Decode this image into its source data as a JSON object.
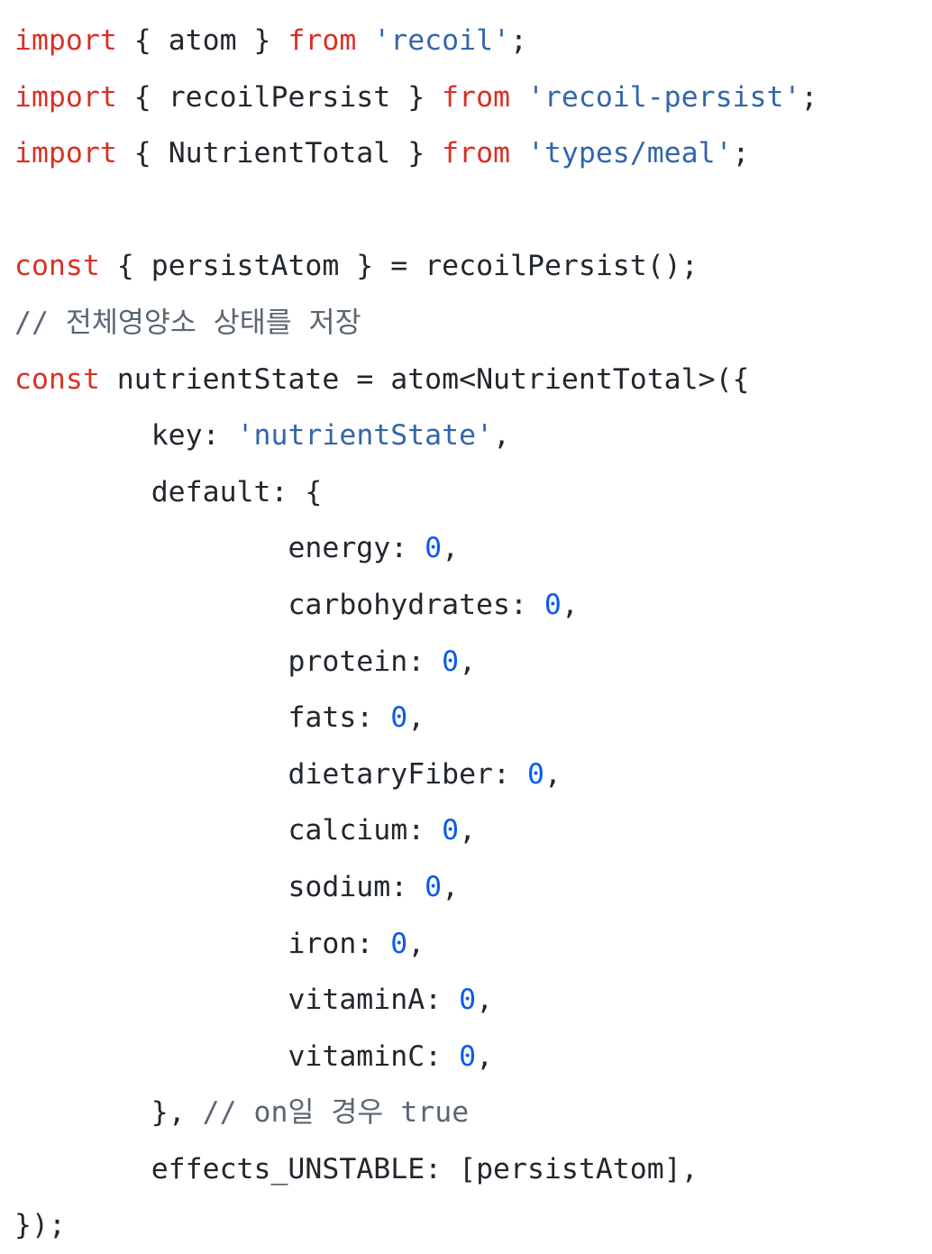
{
  "editor": {
    "language": "typescript",
    "background": "#ffffff",
    "colors": {
      "keyword": "#d93025",
      "string": "#3366aa",
      "function": "#7b5fc4",
      "property": "#2d6bbf",
      "number": "#0a5ce8",
      "comment": "#5a6672",
      "punctuation": "#c88a28",
      "plain": "#22272e",
      "operator": "#2d6bbf"
    }
  },
  "code": {
    "lines": [
      {
        "index": 1,
        "text": "import { atom } from 'recoil';",
        "tokens": [
          {
            "t": "import",
            "c": "keyword"
          },
          {
            "t": " ",
            "c": "plain"
          },
          {
            "t": "{ atom }",
            "c": "plain"
          },
          {
            "t": " ",
            "c": "plain"
          },
          {
            "t": "from",
            "c": "keyword"
          },
          {
            "t": " ",
            "c": "plain"
          },
          {
            "t": "'recoil'",
            "c": "string"
          },
          {
            "t": ";",
            "c": "plain"
          }
        ]
      },
      {
        "index": 2,
        "text": "import { recoilPersist } from 'recoil-persist';",
        "tokens": [
          {
            "t": "import",
            "c": "keyword"
          },
          {
            "t": " ",
            "c": "plain"
          },
          {
            "t": "{ recoilPersist }",
            "c": "plain"
          },
          {
            "t": " ",
            "c": "plain"
          },
          {
            "t": "from",
            "c": "keyword"
          },
          {
            "t": " ",
            "c": "plain"
          },
          {
            "t": "'recoil-persist'",
            "c": "string"
          },
          {
            "t": ";",
            "c": "plain"
          }
        ]
      },
      {
        "index": 3,
        "text": "import { NutrientTotal } from 'types/meal';",
        "tokens": [
          {
            "t": "import",
            "c": "keyword"
          },
          {
            "t": " ",
            "c": "plain"
          },
          {
            "t": "{ NutrientTotal }",
            "c": "plain"
          },
          {
            "t": " ",
            "c": "plain"
          },
          {
            "t": "from",
            "c": "keyword"
          },
          {
            "t": " ",
            "c": "plain"
          },
          {
            "t": "'types/meal'",
            "c": "string"
          },
          {
            "t": ";",
            "c": "plain"
          }
        ]
      },
      {
        "index": 4,
        "text": "",
        "tokens": []
      },
      {
        "index": 5,
        "text": "const { persistAtom } = recoilPersist();",
        "tokens": [
          {
            "t": "const",
            "c": "keyword"
          },
          {
            "t": " ",
            "c": "plain"
          },
          {
            "t": "{ persistAtom }",
            "c": "plain"
          },
          {
            "t": " ",
            "c": "plain"
          },
          {
            "t": "=",
            "c": "operator"
          },
          {
            "t": " ",
            "c": "plain"
          },
          {
            "t": "recoilPersist",
            "c": "function"
          },
          {
            "t": "()",
            "c": "punctuation"
          },
          {
            "t": ";",
            "c": "plain"
          }
        ]
      },
      {
        "index": 6,
        "text": "// 전체영양소 상태를 저장",
        "tokens": [
          {
            "t": "// 전체영양소 상태를 저장",
            "c": "comment"
          }
        ]
      },
      {
        "index": 7,
        "text": "const nutrientState = atom<NutrientTotal>({",
        "tokens": [
          {
            "t": "const",
            "c": "keyword"
          },
          {
            "t": " nutrientState ",
            "c": "plain"
          },
          {
            "t": "=",
            "c": "operator"
          },
          {
            "t": " ",
            "c": "plain"
          },
          {
            "t": "atom",
            "c": "function"
          },
          {
            "t": "<NutrientTotal>",
            "c": "plain"
          },
          {
            "t": "({",
            "c": "punctuation"
          }
        ]
      },
      {
        "index": 8,
        "text": "        key: 'nutrientState',",
        "tokens": [
          {
            "t": "        ",
            "c": "plain"
          },
          {
            "t": "key",
            "c": "property"
          },
          {
            "t": ": ",
            "c": "plain"
          },
          {
            "t": "'nutrientState'",
            "c": "string"
          },
          {
            "t": ",",
            "c": "plain"
          }
        ]
      },
      {
        "index": 9,
        "text": "        default: {",
        "tokens": [
          {
            "t": "        ",
            "c": "plain"
          },
          {
            "t": "default",
            "c": "property"
          },
          {
            "t": ": ",
            "c": "plain"
          },
          {
            "t": "{",
            "c": "punctuation"
          }
        ]
      },
      {
        "index": 10,
        "text": "                energy: 0,",
        "tokens": [
          {
            "t": "                ",
            "c": "plain"
          },
          {
            "t": "energy",
            "c": "property"
          },
          {
            "t": ": ",
            "c": "plain"
          },
          {
            "t": "0",
            "c": "number"
          },
          {
            "t": ",",
            "c": "plain"
          }
        ]
      },
      {
        "index": 11,
        "text": "                carbohydrates: 0,",
        "tokens": [
          {
            "t": "                ",
            "c": "plain"
          },
          {
            "t": "carbohydrates",
            "c": "property"
          },
          {
            "t": ": ",
            "c": "plain"
          },
          {
            "t": "0",
            "c": "number"
          },
          {
            "t": ",",
            "c": "plain"
          }
        ]
      },
      {
        "index": 12,
        "text": "                protein: 0,",
        "tokens": [
          {
            "t": "                ",
            "c": "plain"
          },
          {
            "t": "protein",
            "c": "property"
          },
          {
            "t": ": ",
            "c": "plain"
          },
          {
            "t": "0",
            "c": "number"
          },
          {
            "t": ",",
            "c": "plain"
          }
        ]
      },
      {
        "index": 13,
        "text": "                fats: 0,",
        "tokens": [
          {
            "t": "                ",
            "c": "plain"
          },
          {
            "t": "fats",
            "c": "property"
          },
          {
            "t": ": ",
            "c": "plain"
          },
          {
            "t": "0",
            "c": "number"
          },
          {
            "t": ",",
            "c": "plain"
          }
        ]
      },
      {
        "index": 14,
        "text": "                dietaryFiber: 0,",
        "tokens": [
          {
            "t": "                ",
            "c": "plain"
          },
          {
            "t": "dietaryFiber",
            "c": "property"
          },
          {
            "t": ": ",
            "c": "plain"
          },
          {
            "t": "0",
            "c": "number"
          },
          {
            "t": ",",
            "c": "plain"
          }
        ]
      },
      {
        "index": 15,
        "text": "                calcium: 0,",
        "tokens": [
          {
            "t": "                ",
            "c": "plain"
          },
          {
            "t": "calcium",
            "c": "property"
          },
          {
            "t": ": ",
            "c": "plain"
          },
          {
            "t": "0",
            "c": "number"
          },
          {
            "t": ",",
            "c": "plain"
          }
        ]
      },
      {
        "index": 16,
        "text": "                sodium: 0,",
        "tokens": [
          {
            "t": "                ",
            "c": "plain"
          },
          {
            "t": "sodium",
            "c": "property"
          },
          {
            "t": ": ",
            "c": "plain"
          },
          {
            "t": "0",
            "c": "number"
          },
          {
            "t": ",",
            "c": "plain"
          }
        ]
      },
      {
        "index": 17,
        "text": "                iron: 0,",
        "tokens": [
          {
            "t": "                ",
            "c": "plain"
          },
          {
            "t": "iron",
            "c": "property"
          },
          {
            "t": ": ",
            "c": "plain"
          },
          {
            "t": "0",
            "c": "number"
          },
          {
            "t": ",",
            "c": "plain"
          }
        ]
      },
      {
        "index": 18,
        "text": "                vitaminA: 0,",
        "tokens": [
          {
            "t": "                ",
            "c": "plain"
          },
          {
            "t": "vitaminA",
            "c": "property"
          },
          {
            "t": ": ",
            "c": "plain"
          },
          {
            "t": "0",
            "c": "number"
          },
          {
            "t": ",",
            "c": "plain"
          }
        ]
      },
      {
        "index": 19,
        "text": "                vitaminC: 0,",
        "tokens": [
          {
            "t": "                ",
            "c": "plain"
          },
          {
            "t": "vitaminC",
            "c": "property"
          },
          {
            "t": ": ",
            "c": "plain"
          },
          {
            "t": "0",
            "c": "number"
          },
          {
            "t": ",",
            "c": "plain"
          }
        ]
      },
      {
        "index": 20,
        "text": "        }, // on일 경우 true",
        "tokens": [
          {
            "t": "        ",
            "c": "plain"
          },
          {
            "t": "}",
            "c": "punctuation"
          },
          {
            "t": ", ",
            "c": "plain"
          },
          {
            "t": "// on일 경우 true",
            "c": "comment"
          }
        ]
      },
      {
        "index": 21,
        "text": "        effects_UNSTABLE: [persistAtom],",
        "tokens": [
          {
            "t": "        ",
            "c": "plain"
          },
          {
            "t": "effects_UNSTABLE",
            "c": "property"
          },
          {
            "t": ": ",
            "c": "plain"
          },
          {
            "t": "[",
            "c": "punctuation"
          },
          {
            "t": "persistAtom",
            "c": "plain"
          },
          {
            "t": "]",
            "c": "punctuation"
          },
          {
            "t": ",",
            "c": "plain"
          }
        ]
      },
      {
        "index": 22,
        "text": "});",
        "tokens": [
          {
            "t": "})",
            "c": "punctuation"
          },
          {
            "t": ";",
            "c": "operator"
          }
        ]
      }
    ]
  }
}
